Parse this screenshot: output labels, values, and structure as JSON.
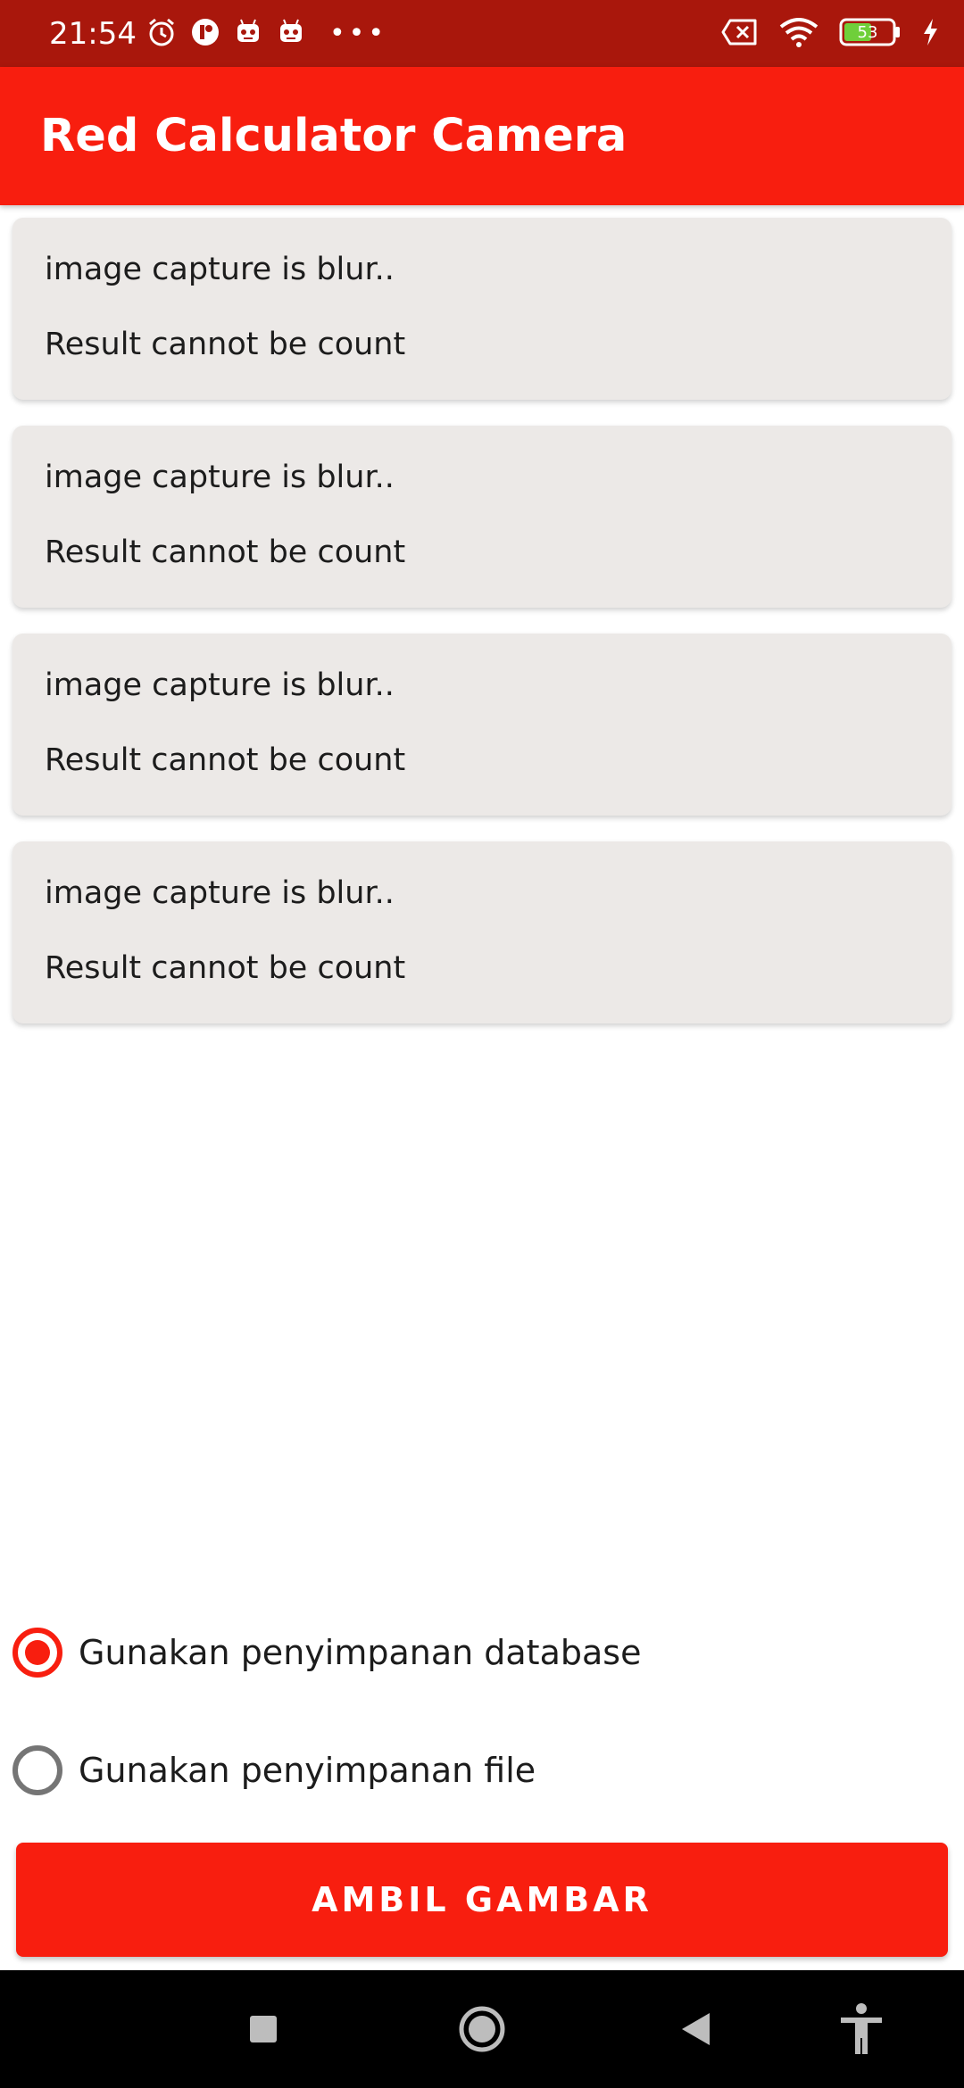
{
  "status_bar": {
    "time": "21:54",
    "battery_level": "53",
    "icons": [
      "alarm-icon",
      "app-notification-icon",
      "robot-icon",
      "robot-icon",
      "more-dots-icon",
      "no-sim-icon",
      "wifi-icon",
      "battery-icon",
      "charging-icon"
    ]
  },
  "app_bar": {
    "title": "Red Calculator Camera"
  },
  "results": [
    {
      "line1": "image capture is blur..",
      "line2": "Result cannot be count"
    },
    {
      "line1": "image capture is blur..",
      "line2": "Result cannot be count"
    },
    {
      "line1": "image capture is blur..",
      "line2": "Result cannot be count"
    },
    {
      "line1": "image capture is blur..",
      "line2": "Result cannot be count"
    }
  ],
  "storage_options": [
    {
      "label": "Gunakan penyimpanan database",
      "checked": true
    },
    {
      "label": "Gunakan penyimpanan file",
      "checked": false
    }
  ],
  "action_button": {
    "label": "AMBIL GAMBAR"
  },
  "colors": {
    "accent": "#f81e0f",
    "status_bar": "#a9170c",
    "card": "#ece9e7"
  },
  "nav_bar": {
    "icons": [
      "recents-square-icon",
      "home-circle-icon",
      "back-triangle-icon",
      "accessibility-icon"
    ]
  }
}
